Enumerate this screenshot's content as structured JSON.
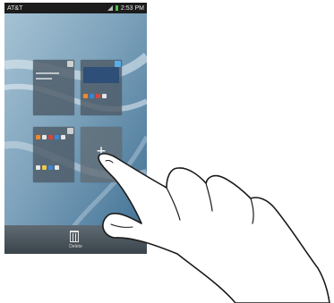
{
  "status_bar": {
    "carrier": "AT&T",
    "time": "2:53 PM"
  },
  "home_panels": [
    {
      "name": "panel-1",
      "home": false
    },
    {
      "name": "panel-2",
      "home": true
    },
    {
      "name": "panel-3",
      "home": false
    },
    {
      "name": "panel-add",
      "icon": "plus-icon"
    }
  ],
  "add_panel": {
    "glyph": "+"
  },
  "bottom_bar": {
    "delete_label": "Delete",
    "delete_icon": "trash-icon"
  },
  "overlay": {
    "icon": "pointing-hand-icon"
  },
  "colors": {
    "status_bar_bg": "#1c1c1c",
    "battery": "#48c642",
    "home_indicator": "#59aee6"
  }
}
